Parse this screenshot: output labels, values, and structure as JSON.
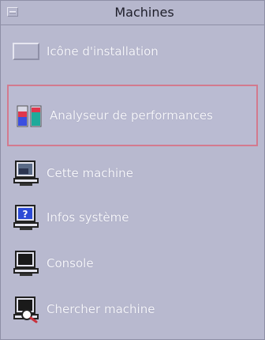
{
  "window": {
    "title": "Machines"
  },
  "items": [
    {
      "label": "Icône d'installation",
      "icon": "install-drop-icon"
    },
    {
      "label": "Analyseur de performances",
      "icon": "performance-meter-icon"
    },
    {
      "label": "Cette machine",
      "icon": "computer-icon"
    },
    {
      "label": "Infos système",
      "icon": "system-info-icon"
    },
    {
      "label": "Console",
      "icon": "console-icon"
    },
    {
      "label": "Chercher machine",
      "icon": "find-machine-icon"
    }
  ],
  "colors": {
    "panel": "#b8b9cf",
    "selection_border": "#d37a8e",
    "perf_red": "#e0374d",
    "perf_blue": "#3b4fe0",
    "perf_teal": "#1faa9b"
  }
}
